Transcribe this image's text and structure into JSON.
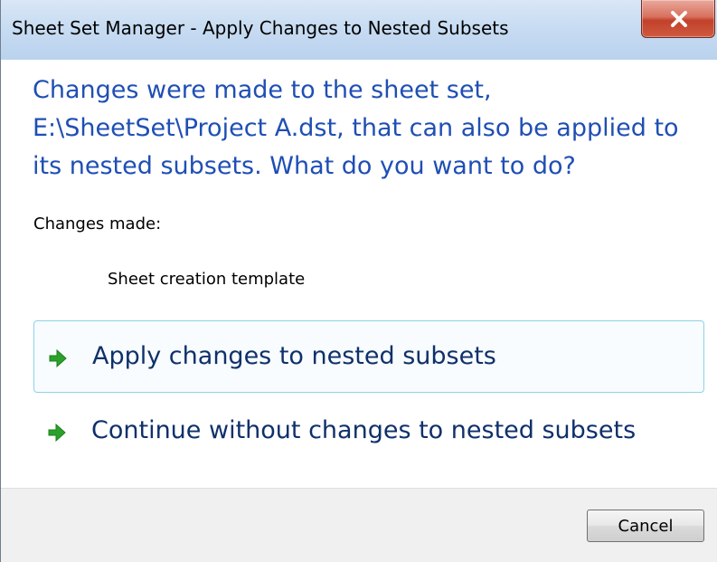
{
  "window": {
    "title": "Sheet Set Manager - Apply Changes to Nested Subsets"
  },
  "dialog": {
    "instruction_lines": [
      "Changes were made to the sheet set,",
      "E:\\SheetSet\\Project A.dst, that can also be applied to",
      "its nested subsets. What do you want to do?"
    ],
    "changes_label": "Changes made:",
    "changes_items": [
      "Sheet creation template"
    ],
    "options": [
      {
        "label": "Apply changes to nested subsets",
        "icon": "green-arrow-icon"
      },
      {
        "label": "Continue without changes to nested subsets",
        "icon": "green-arrow-icon"
      }
    ],
    "cancel_label": "Cancel"
  },
  "colors": {
    "instruction_text": "#1f4fb4",
    "option_text": "#10306b",
    "arrow_green": "#2aa22a",
    "hover_border": "#8ed2e6"
  }
}
